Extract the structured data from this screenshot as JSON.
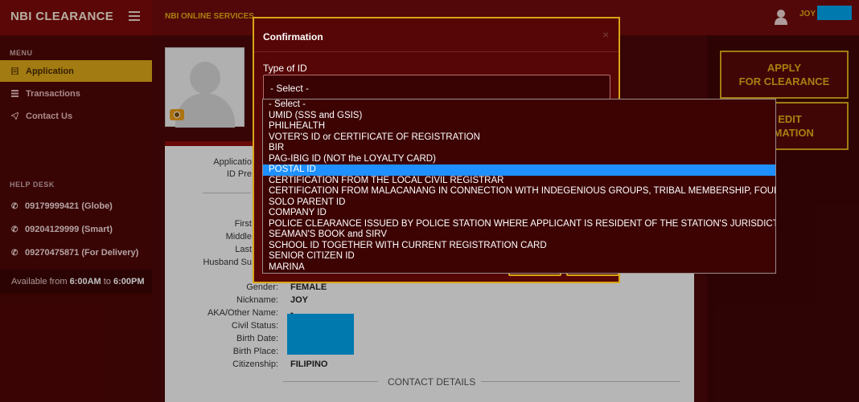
{
  "header": {
    "brand": "NBI CLEARANCE",
    "services": "NBI ONLINE SERVICES",
    "user_name": "JOY"
  },
  "sidebar": {
    "menu_heading": "MENU",
    "items": [
      {
        "label": "Application",
        "icon": "document-icon",
        "active": true
      },
      {
        "label": "Transactions",
        "icon": "list-icon",
        "active": false
      },
      {
        "label": "Contact Us",
        "icon": "paper-plane-icon",
        "active": false
      }
    ],
    "helpdesk_heading": "HELP DESK",
    "phones": [
      "09179999421 (Globe)",
      "09204129999 (Smart)",
      "09270475871 (For Delivery)"
    ],
    "availability_prefix": "Available from ",
    "availability_start": "6:00AM",
    "availability_mid": " to ",
    "availability_end": "6:00PM"
  },
  "profile": {
    "labels_partial": {
      "application": "Applicatio",
      "id_presented": "ID Pre",
      "first": "First",
      "middle": "Middle",
      "last": "Last",
      "husband": "Husband Su"
    },
    "fields": [
      {
        "label": "Gender:",
        "value": "FEMALE"
      },
      {
        "label": "Nickname:",
        "value": "JOY"
      },
      {
        "label": "AKA/Other Name:",
        "value": "-"
      },
      {
        "label": "Civil Status:",
        "value": ""
      },
      {
        "label": "Birth Date:",
        "value": ""
      },
      {
        "label": "Birth Place:",
        "value": ""
      },
      {
        "label": "Citizenship:",
        "value": "FILIPINO"
      }
    ],
    "contact_heading": "CONTACT DETAILS"
  },
  "right_panel": {
    "apply_line1": "APPLY",
    "apply_line2": "FOR CLEARANCE",
    "edit_line1": "EDIT",
    "edit_line2": "RMATION"
  },
  "modal": {
    "title": "Confirmation",
    "close_glyph": "×",
    "field_label": "Type of ID",
    "selected_value": "- Select -",
    "options": [
      "- Select -",
      "UMID (SSS and GSIS)",
      "PHILHEALTH",
      "VOTER'S ID or CERTIFICATE OF REGISTRATION",
      "BIR",
      "PAG-IBIG ID (NOT the LOYALTY CARD)",
      "POSTAL ID",
      "CERTIFICATION FROM THE LOCAL CIVIL REGISTRAR",
      "CERTIFICATION FROM MALACANANG IN CONNECTION WITH INDEGENIOUS GROUPS, TRIBAL MEMBERSHIP, FOUNDLING",
      "SOLO PARENT ID",
      "COMPANY ID",
      "POLICE CLEARANCE ISSUED BY POLICE STATION WHERE APPLICANT IS RESIDENT OF THE STATION'S JURISDICTION",
      "SEAMAN'S BOOK and SIRV",
      "SCHOOL ID TOGETHER WITH CURRENT REGISTRATION CARD",
      "SENIOR CITIZEN ID",
      "MARINA"
    ],
    "highlighted_index": 6
  },
  "colors": {
    "accent": "#d9a518",
    "brand_red": "#7a0a0a",
    "highlight": "#1e90ff",
    "redaction": "#00a2e8"
  }
}
